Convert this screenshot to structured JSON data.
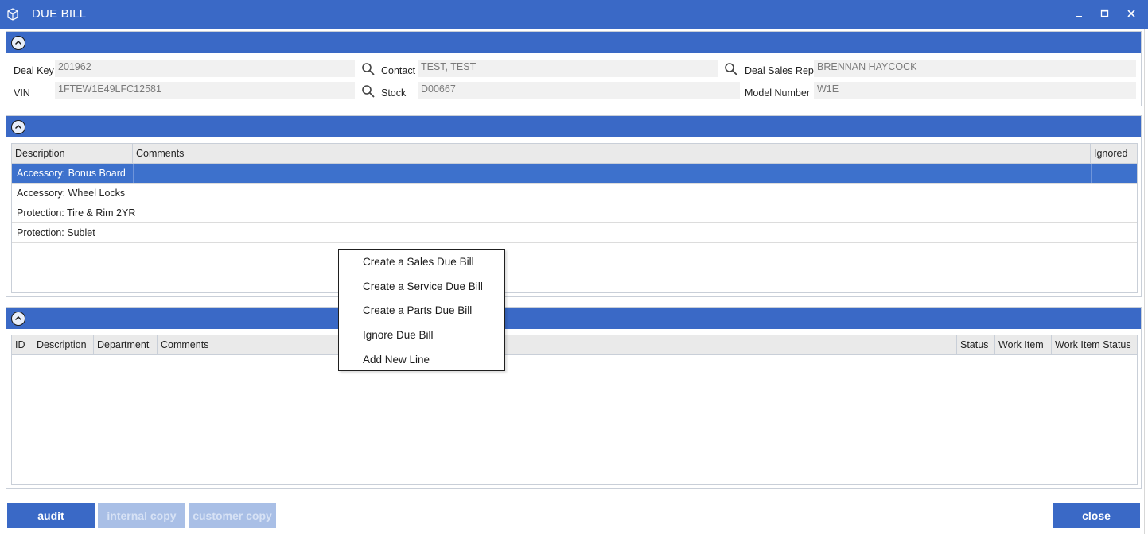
{
  "window": {
    "title": "DUE BILL",
    "icons": {
      "app": "cube-icon",
      "minimize": "minimize-icon",
      "maximize": "maximize-icon",
      "close": "close-icon"
    }
  },
  "deal_panel": {
    "deal_key": {
      "label": "Deal Key",
      "value": "201962"
    },
    "vin": {
      "label": "VIN",
      "value": "1FTEW1E49LFC12581"
    },
    "contact": {
      "label": "Contact",
      "value": "TEST, TEST"
    },
    "stock": {
      "label": "Stock",
      "value": "D00667"
    },
    "deal_sales_rep": {
      "label": "Deal Sales Rep",
      "value": "BRENNAN HAYCOCK"
    },
    "model_number": {
      "label": "Model Number",
      "value": "W1E"
    }
  },
  "products_grid": {
    "columns": [
      "Description",
      "Comments",
      "Ignored"
    ],
    "rows": [
      {
        "description": "Accessory: Bonus Board",
        "comments": "",
        "ignored": "",
        "selected": true
      },
      {
        "description": "Accessory: Wheel Locks",
        "comments": "",
        "ignored": ""
      },
      {
        "description": "Protection: Tire & Rim 2YR",
        "comments": "",
        "ignored": ""
      },
      {
        "description": "Protection: Sublet",
        "comments": "",
        "ignored": ""
      }
    ]
  },
  "due_bill_grid": {
    "columns": [
      "ID",
      "Description",
      "Department",
      "Comments",
      "Status",
      "Work Item",
      "Work Item Status"
    ],
    "rows": []
  },
  "context_menu": {
    "items": [
      "Create a Sales Due Bill",
      "Create a Service Due Bill",
      "Create a Parts Due Bill",
      "Ignore Due Bill",
      "Add New Line"
    ]
  },
  "buttons": {
    "audit": "audit",
    "internal_copy": "internal copy",
    "customer_copy": "customer copy",
    "close": "close"
  },
  "colors": {
    "accent": "#3a69c6",
    "selected_row": "#3d71cc",
    "disabled_button": "#a9bfe6"
  }
}
